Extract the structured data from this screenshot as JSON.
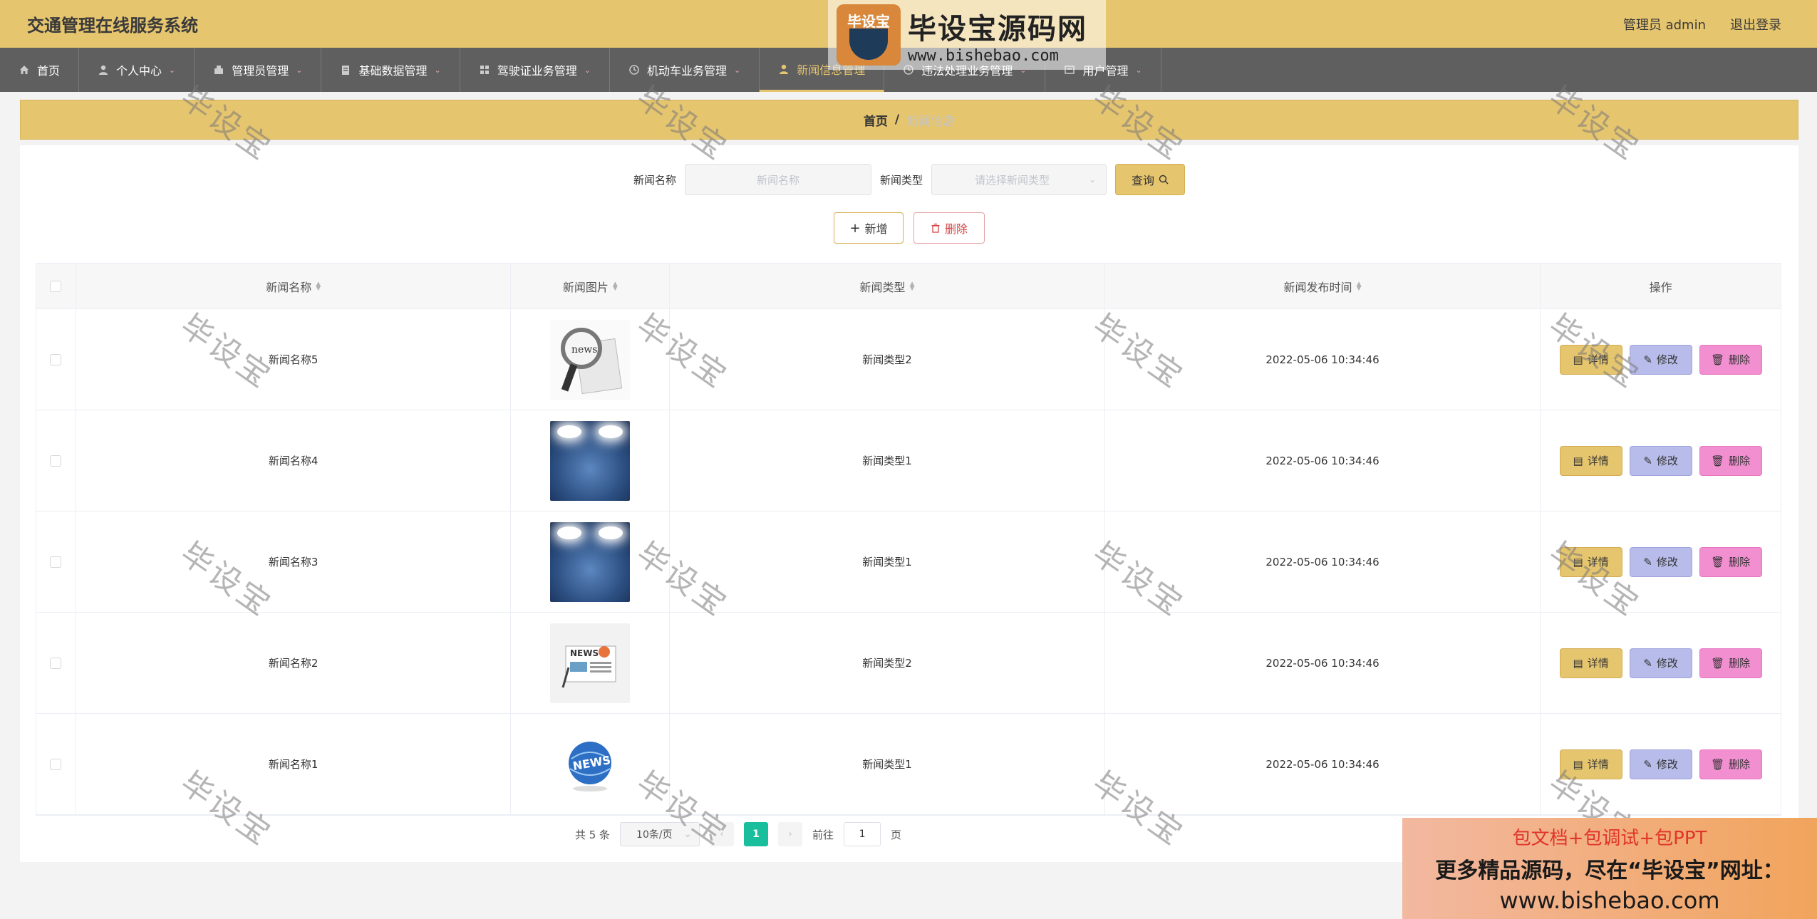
{
  "header": {
    "title": "交通管理在线服务系统",
    "user": "管理员 admin",
    "logout": "退出登录"
  },
  "nav": [
    {
      "label": "首页",
      "icon": "home-icon"
    },
    {
      "label": "个人中心",
      "icon": "user-icon"
    },
    {
      "label": "管理员管理",
      "icon": "admin-icon"
    },
    {
      "label": "基础数据管理",
      "icon": "clipboard-icon"
    },
    {
      "label": "驾驶证业务管理",
      "icon": "grid-icon"
    },
    {
      "label": "机动车业务管理",
      "icon": "clock-icon"
    },
    {
      "label": "新闻信息管理",
      "icon": "user-icon"
    },
    {
      "label": "违法处理业务管理",
      "icon": "clock-icon"
    },
    {
      "label": "用户管理",
      "icon": "box-icon"
    }
  ],
  "breadcrumb": {
    "home": "首页",
    "sep": "/",
    "current": "新闻信息"
  },
  "search": {
    "name_label": "新闻名称",
    "name_placeholder": "新闻名称",
    "type_label": "新闻类型",
    "type_placeholder": "请选择新闻类型",
    "query_label": "查询"
  },
  "actions": {
    "add_label": "新增",
    "delete_label": "删除"
  },
  "table": {
    "headers": {
      "name": "新闻名称",
      "image": "新闻图片",
      "type": "新闻类型",
      "time": "新闻发布时间",
      "ops": "操作"
    },
    "rows": [
      {
        "name": "新闻名称5",
        "image": "magnifier-news",
        "type": "新闻类型2",
        "time": "2022-05-06 10:34:46"
      },
      {
        "name": "新闻名称4",
        "image": "stage-news",
        "type": "新闻类型1",
        "time": "2022-05-06 10:34:46"
      },
      {
        "name": "新闻名称3",
        "image": "stage-news",
        "type": "新闻类型1",
        "time": "2022-05-06 10:34:46"
      },
      {
        "name": "新闻名称2",
        "image": "paper-news",
        "type": "新闻类型2",
        "time": "2022-05-06 10:34:46"
      },
      {
        "name": "新闻名称1",
        "image": "globe-news",
        "type": "新闻类型1",
        "time": "2022-05-06 10:34:46"
      }
    ],
    "op_detail": "详情",
    "op_edit": "修改",
    "op_delete": "删除"
  },
  "pagination": {
    "total": "共 5 条",
    "page_size": "10条/页",
    "current": "1",
    "goto_prefix": "前往",
    "goto_value": "1",
    "goto_suffix": "页"
  },
  "watermark": "毕设宝",
  "logo": {
    "badge": "毕设宝",
    "cn": "毕设宝源码网",
    "url": "www.bishebao.com"
  },
  "promo": {
    "line1": "包文档+包调试+包PPT",
    "line2": "更多精品源码，尽在“毕设宝”网址：",
    "line3": "www.bishebao.com"
  },
  "colors": {
    "accent": "#e6c56f",
    "nav_bg": "#5f5f5f",
    "edit": "#b8bcea",
    "delete": "#f28fd1",
    "page_active": "#19be9c"
  }
}
